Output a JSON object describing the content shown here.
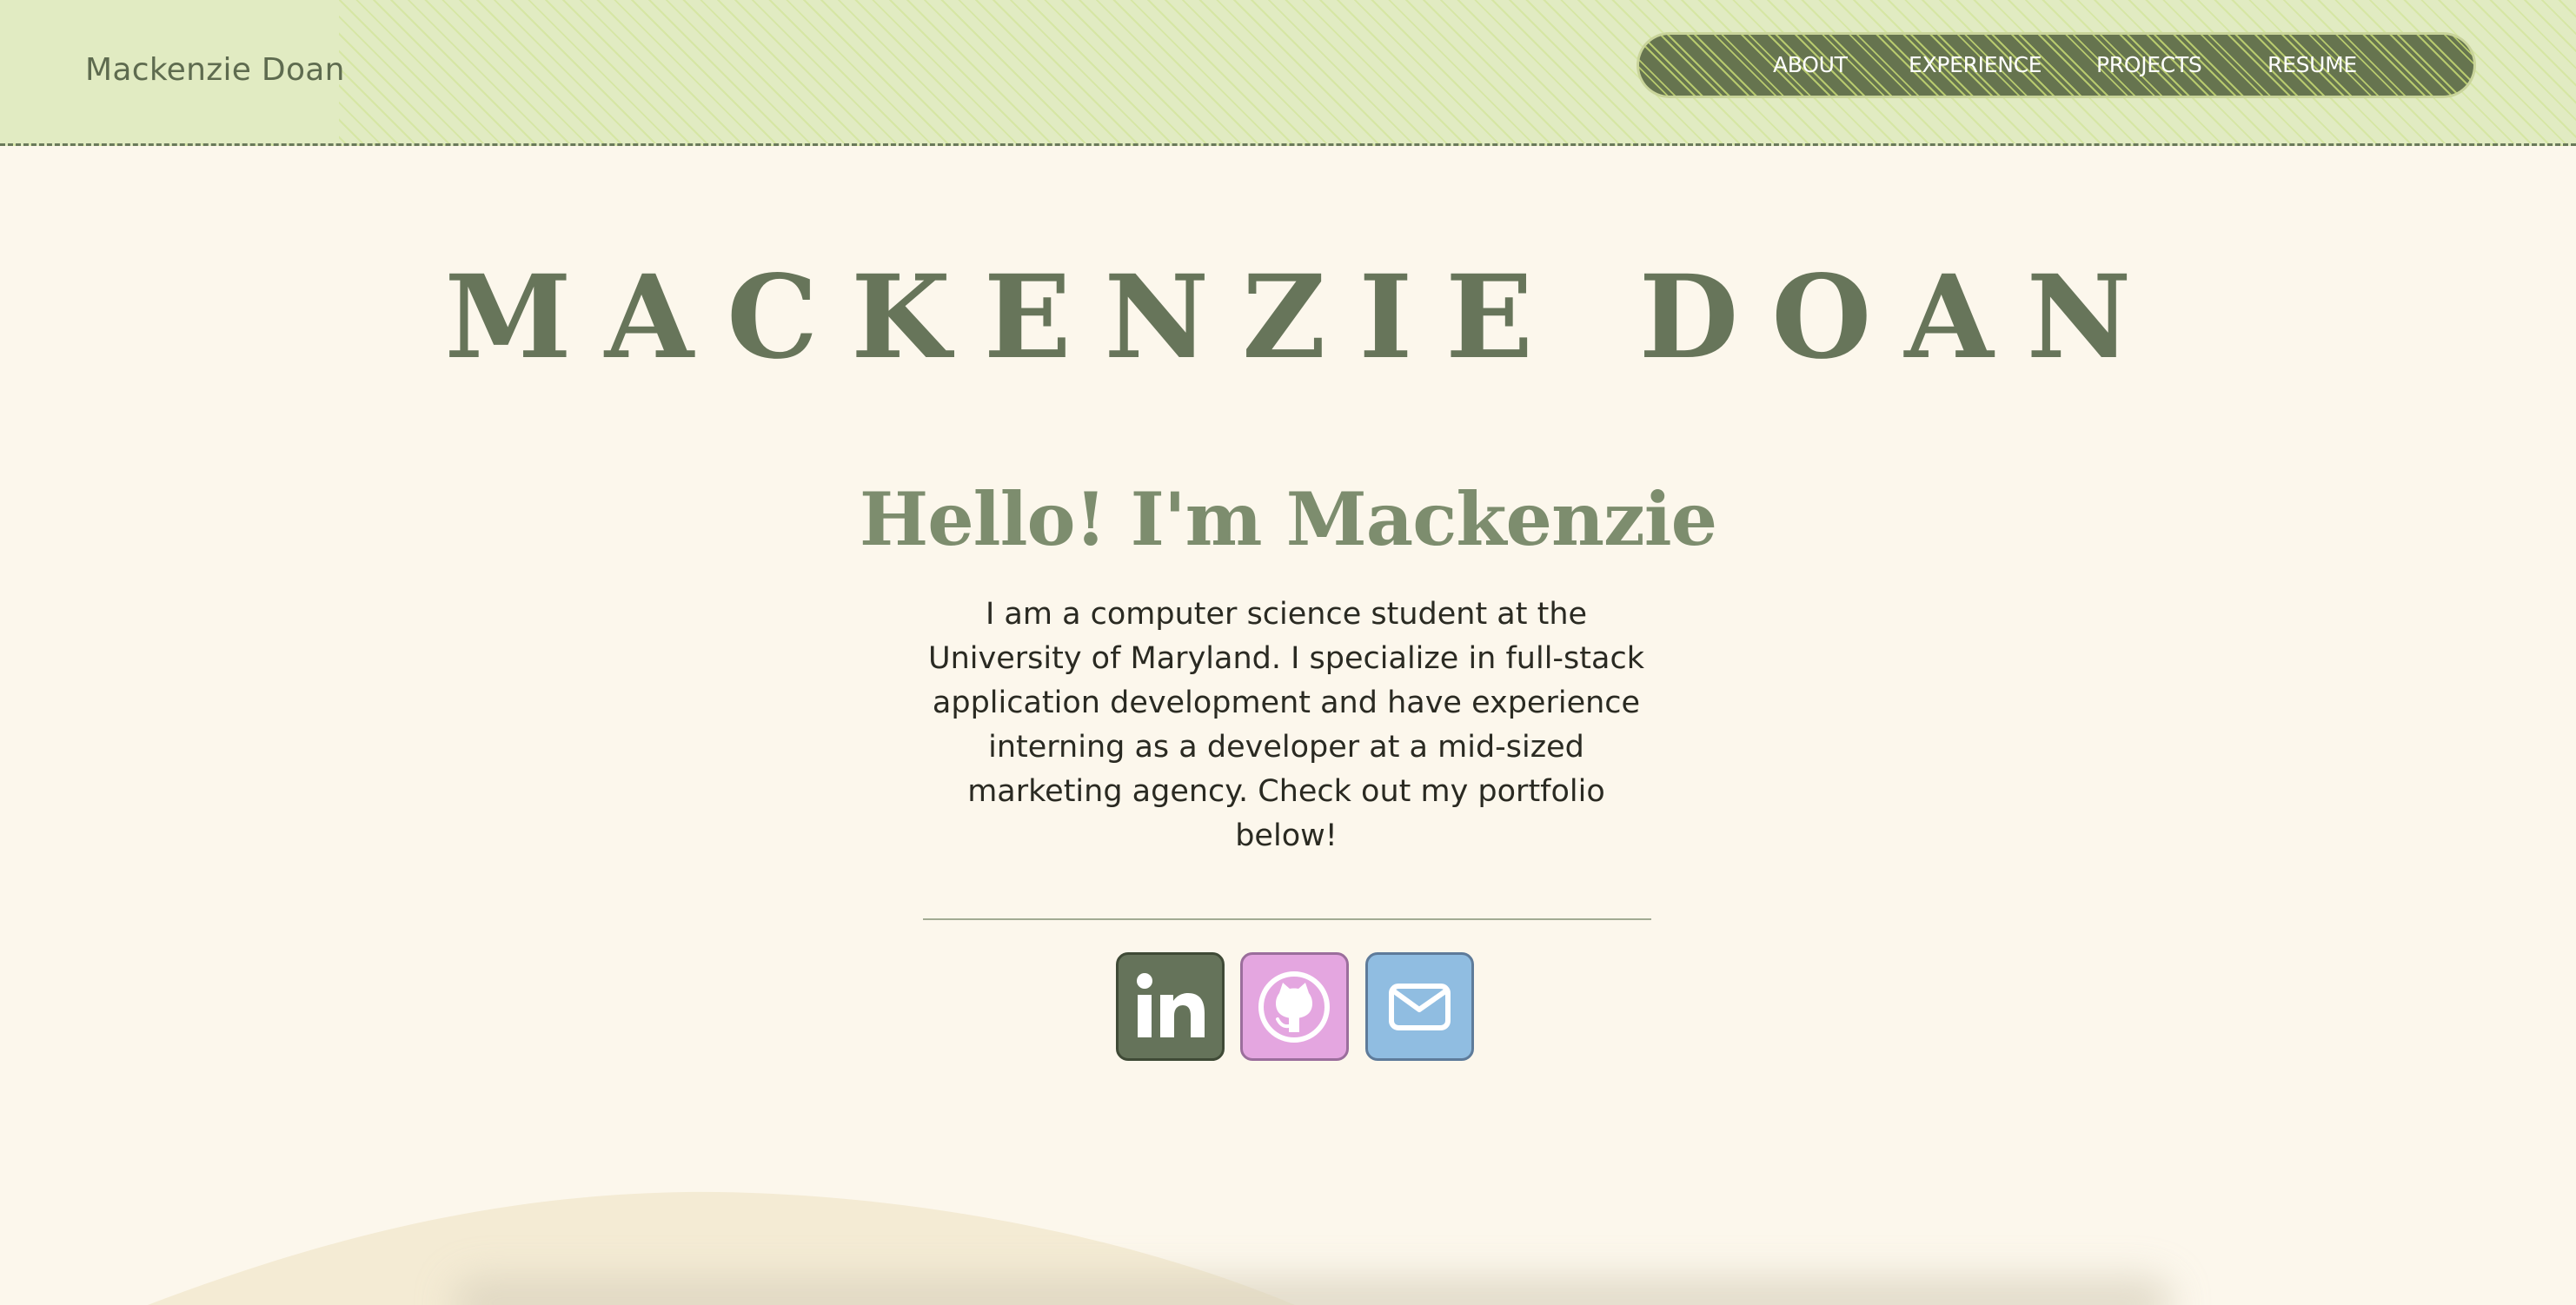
{
  "header": {
    "brand": "Mackenzie Doan",
    "nav": [
      {
        "label": "ABOUT"
      },
      {
        "label": "EXPERIENCE"
      },
      {
        "label": "PROJECTS"
      },
      {
        "label": "RESUME"
      }
    ]
  },
  "hero": {
    "title": "MACKENZIE DOAN",
    "greeting": "Hello! I'm Mackenzie",
    "bio": "I am a computer science student at the University of Maryland. I specialize in full-stack application development and have experience interning as a developer at a mid-sized marketing agency. Check out my portfolio below!"
  },
  "social": [
    {
      "icon": "linkedin-icon",
      "color": "#65735a"
    },
    {
      "icon": "github-icon",
      "color": "#e4a6e0"
    },
    {
      "icon": "mail-icon",
      "color": "#90bde1"
    }
  ],
  "colors": {
    "header_bg": "#e1ebc2",
    "nav_bg": "#66744f",
    "page_bg": "#fcf7ec",
    "title": "#67755a",
    "greeting": "#7d8d6e"
  }
}
